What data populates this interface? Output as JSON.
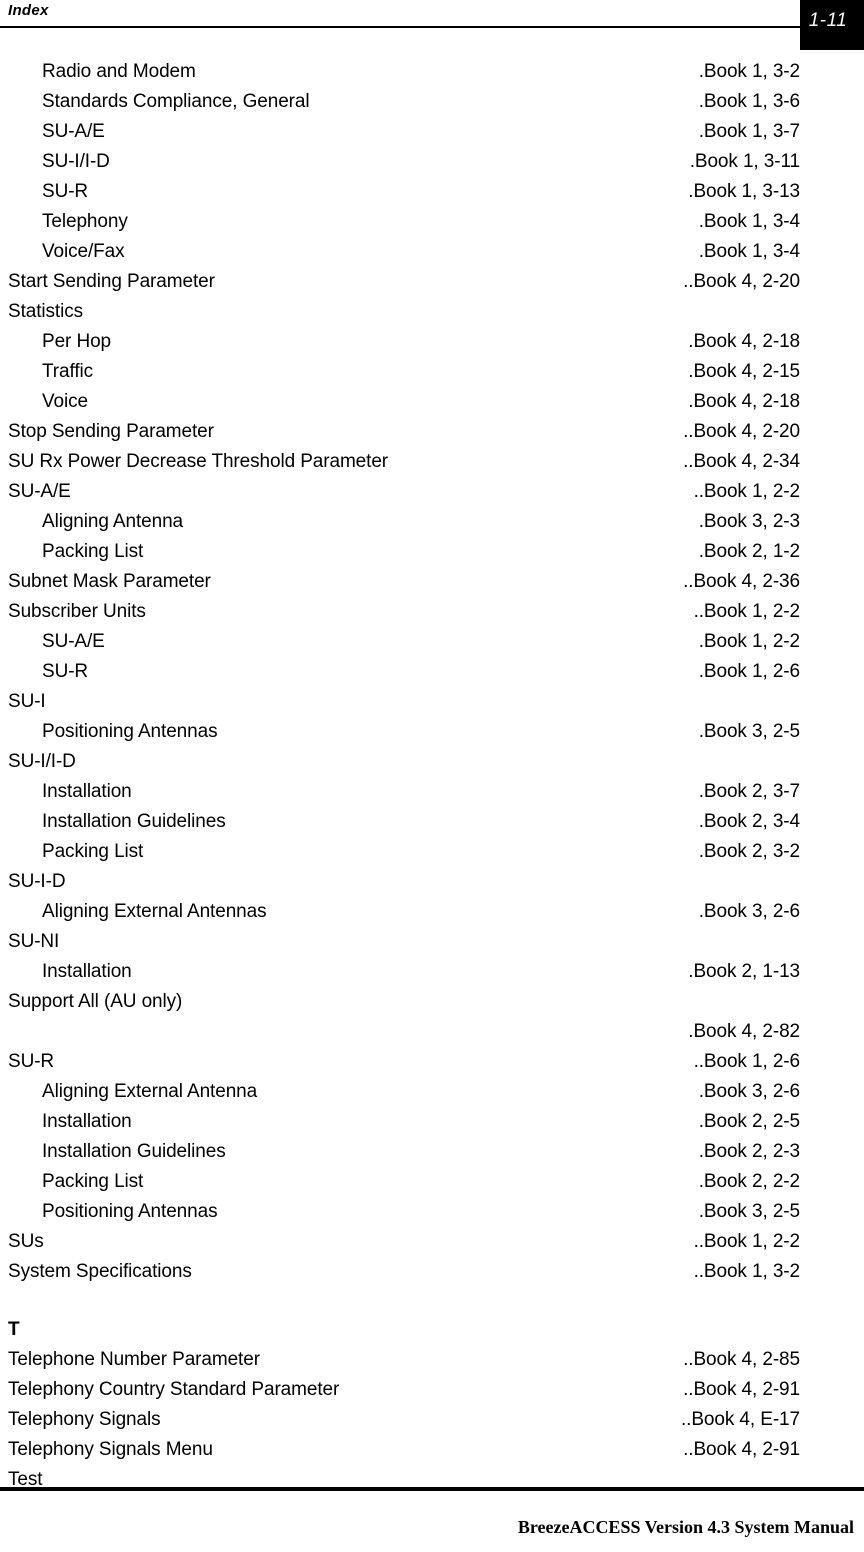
{
  "header": {
    "title": "Index",
    "page_number": "1-11"
  },
  "footer": {
    "text": "BreezeACCESS Version 4.3 System Manual"
  },
  "index": {
    "entries": [
      {
        "label": "Radio and Modem",
        "ref": ".Book 1, 3-2",
        "level": 1
      },
      {
        "label": "Standards Compliance, General",
        "ref": ".Book 1, 3-6",
        "level": 1
      },
      {
        "label": "SU-A/E",
        "ref": ".Book 1, 3-7",
        "level": 1
      },
      {
        "label": "SU-I/I-D",
        "ref": ".Book 1, 3-11",
        "level": 1
      },
      {
        "label": "SU-R",
        "ref": ".Book 1, 3-13",
        "level": 1
      },
      {
        "label": "Telephony",
        "ref": ".Book 1, 3-4",
        "level": 1
      },
      {
        "label": "Voice/Fax",
        "ref": ".Book 1, 3-4",
        "level": 1
      },
      {
        "label": "Start Sending Parameter",
        "ref": "..Book 4, 2-20",
        "level": 0
      },
      {
        "label": "Statistics",
        "ref": "",
        "level": 0
      },
      {
        "label": "Per Hop",
        "ref": ".Book 4, 2-18",
        "level": 1
      },
      {
        "label": "Traffic",
        "ref": ".Book 4, 2-15",
        "level": 1
      },
      {
        "label": "Voice",
        "ref": ".Book 4, 2-18",
        "level": 1
      },
      {
        "label": "Stop Sending Parameter",
        "ref": "..Book 4, 2-20",
        "level": 0
      },
      {
        "label": "SU Rx Power Decrease Threshold Parameter",
        "ref": "..Book 4, 2-34",
        "level": 0
      },
      {
        "label": "SU-A/E",
        "ref": "..Book 1, 2-2",
        "level": 0
      },
      {
        "label": "Aligning Antenna",
        "ref": ".Book 3, 2-3",
        "level": 1
      },
      {
        "label": "Packing List",
        "ref": ".Book 2, 1-2",
        "level": 1
      },
      {
        "label": "Subnet Mask Parameter",
        "ref": "..Book 4, 2-36",
        "level": 0
      },
      {
        "label": "Subscriber Units",
        "ref": "..Book 1, 2-2",
        "level": 0
      },
      {
        "label": "SU-A/E",
        "ref": ".Book 1, 2-2",
        "level": 1
      },
      {
        "label": "SU-R",
        "ref": ".Book 1, 2-6",
        "level": 1
      },
      {
        "label": "SU-I",
        "ref": "",
        "level": 0
      },
      {
        "label": "Positioning Antennas",
        "ref": ".Book 3, 2-5",
        "level": 1
      },
      {
        "label": "SU-I/I-D",
        "ref": "",
        "level": 0
      },
      {
        "label": "Installation",
        "ref": ".Book 2, 3-7",
        "level": 1
      },
      {
        "label": "Installation Guidelines",
        "ref": ".Book 2, 3-4",
        "level": 1
      },
      {
        "label": "Packing List",
        "ref": ".Book 2, 3-2",
        "level": 1
      },
      {
        "label": "SU-I-D",
        "ref": "",
        "level": 0
      },
      {
        "label": "Aligning External Antennas",
        "ref": ".Book 3, 2-6",
        "level": 1
      },
      {
        "label": "SU-NI",
        "ref": "",
        "level": 0
      },
      {
        "label": "Installation",
        "ref": ".Book 2, 1-13",
        "level": 1
      },
      {
        "label": "Support All (AU only)",
        "ref": "",
        "level": 0
      },
      {
        "label": "",
        "ref": ".Book 4, 2-82",
        "level": 0
      },
      {
        "label": "SU-R",
        "ref": "..Book 1, 2-6",
        "level": 0
      },
      {
        "label": "Aligning External Antenna",
        "ref": ".Book 3, 2-6",
        "level": 1
      },
      {
        "label": "Installation",
        "ref": ".Book 2, 2-5",
        "level": 1
      },
      {
        "label": "Installation Guidelines",
        "ref": ".Book 2, 2-3",
        "level": 1
      },
      {
        "label": "Packing List",
        "ref": ".Book 2, 2-2",
        "level": 1
      },
      {
        "label": "Positioning Antennas",
        "ref": ".Book 3, 2-5",
        "level": 1
      },
      {
        "label": "SUs",
        "ref": "..Book 1, 2-2",
        "level": 0
      },
      {
        "label": "System Specifications",
        "ref": "..Book 1, 3-2",
        "level": 0
      }
    ],
    "section_t": {
      "letter": "T",
      "entries": [
        {
          "label": "Telephone Number Parameter",
          "ref": "..Book 4, 2-85",
          "level": 0
        },
        {
          "label": "Telephony Country Standard Parameter",
          "ref": "..Book 4, 2-91",
          "level": 0
        },
        {
          "label": "Telephony Signals",
          "ref": "..Book 4, E-17",
          "level": 0
        },
        {
          "label": "Telephony Signals Menu",
          "ref": "..Book 4, 2-91",
          "level": 0
        },
        {
          "label": "Test",
          "ref": "",
          "level": 0
        }
      ]
    }
  }
}
